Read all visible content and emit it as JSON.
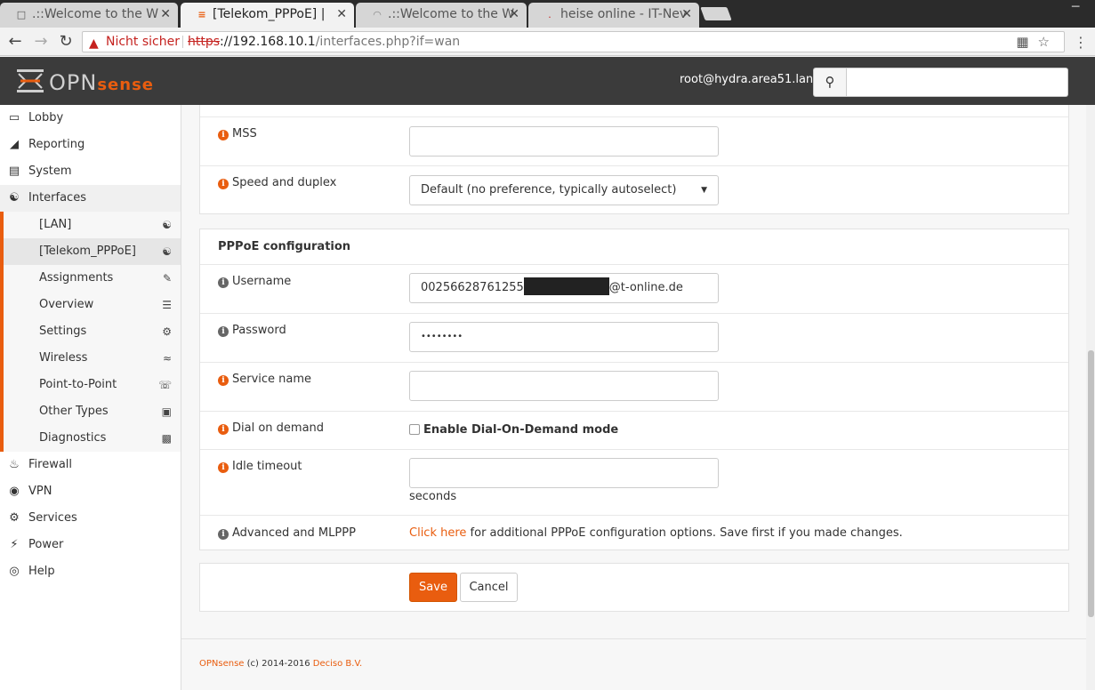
{
  "browser": {
    "tabs": [
      {
        "title": ".::Welcome to the W",
        "active": false,
        "icon": "page-icon"
      },
      {
        "title": "[Telekom_PPPoE] | ",
        "active": true,
        "icon": "opnsense-favicon"
      },
      {
        "title": ".::Welcome to the W",
        "active": false,
        "icon": "loading-spinner-icon"
      },
      {
        "title": "heise online - IT-Nev",
        "active": false,
        "icon": "heise-favicon"
      }
    ],
    "security_warning": "Nicht sicher",
    "url_scheme": "https",
    "url_host": "://192.168.10.1",
    "url_path": "/interfaces.php?if=wan"
  },
  "header": {
    "logo_opn": "OPN",
    "logo_sense": "sense",
    "user": "root@hydra.area51.lan",
    "search_placeholder": ""
  },
  "sidebar": {
    "items_top": [
      {
        "label": "Lobby",
        "icon": "laptop-icon"
      },
      {
        "label": "Reporting",
        "icon": "area-chart-icon"
      },
      {
        "label": "System",
        "icon": "server-icon"
      },
      {
        "label": "Interfaces",
        "icon": "sitemap-icon"
      }
    ],
    "interfaces_sub": [
      {
        "label": "[LAN]",
        "icon": "sitemap-icon"
      },
      {
        "label": "[Telekom_PPPoE]",
        "icon": "sitemap-icon",
        "active": true
      },
      {
        "label": "Assignments",
        "icon": "pencil-icon"
      },
      {
        "label": "Overview",
        "icon": "list-icon"
      },
      {
        "label": "Settings",
        "icon": "cogs-icon"
      },
      {
        "label": "Wireless",
        "icon": "wifi-icon"
      },
      {
        "label": "Point-to-Point",
        "icon": "phone-icon"
      },
      {
        "label": "Other Types",
        "icon": "archive-icon"
      },
      {
        "label": "Diagnostics",
        "icon": "medkit-icon"
      }
    ],
    "items_bottom": [
      {
        "label": "Firewall",
        "icon": "fire-icon"
      },
      {
        "label": "VPN",
        "icon": "globe-icon"
      },
      {
        "label": "Services",
        "icon": "cog-icon"
      },
      {
        "label": "Power",
        "icon": "plug-icon"
      },
      {
        "label": "Help",
        "icon": "life-ring-icon"
      }
    ]
  },
  "general": {
    "mss_label": "MSS",
    "mss_value": "",
    "speed_label": "Speed and duplex",
    "speed_value": "Default (no preference, typically autoselect)"
  },
  "pppoe": {
    "title": "PPPoE configuration",
    "username_label": "Username",
    "username_prefix": "00256628761255",
    "username_suffix": "@t-online.de",
    "password_label": "Password",
    "password_value": "••••••••",
    "service_label": "Service name",
    "service_value": "",
    "dial_label": "Dial on demand",
    "dial_checkbox_label": "Enable Dial-On-Demand mode",
    "dial_checked": false,
    "idle_label": "Idle timeout",
    "idle_value": "",
    "idle_unit": "seconds",
    "advanced_label": "Advanced and MLPPP",
    "advanced_link": "Click here",
    "advanced_text": " for additional PPPoE configuration options. Save first if you made changes."
  },
  "actions": {
    "save": "Save",
    "cancel": "Cancel"
  },
  "footer": {
    "brand": "OPNsense",
    "copyright": " (c) 2014-2016 ",
    "company": "Deciso B.V."
  },
  "colors": {
    "accent": "#e95d0f",
    "header_bg": "#3b3b3b"
  }
}
